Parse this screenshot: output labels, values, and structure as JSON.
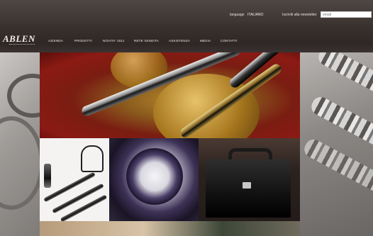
{
  "header": {
    "language_label": "language",
    "language_value": "ITALIANO",
    "newsletter_label": "Iscriviti alla newsletter",
    "newsletter_placeholder": "email"
  },
  "brand": {
    "logo_text": "ABLEN"
  },
  "nav": {
    "items": [
      {
        "label": "AZIENDA"
      },
      {
        "label": "PRODOTTI"
      },
      {
        "label": "NOVITA' 2011"
      },
      {
        "label": "RETE VENDITA"
      },
      {
        "label": "ASSISTENZA"
      },
      {
        "label": "MEDIA"
      },
      {
        "label": "CONTATTI"
      }
    ]
  },
  "icons": {
    "logo": "brand-logo",
    "hero": "fountain-pen-coin-image",
    "tile1": "pen-set-image",
    "tile2": "wristwatch-image",
    "tile3": "briefcase-image"
  },
  "colors": {
    "header_bg": "#3c3431",
    "hero_red": "#8b1a14",
    "page_bg": "#8a8682"
  }
}
